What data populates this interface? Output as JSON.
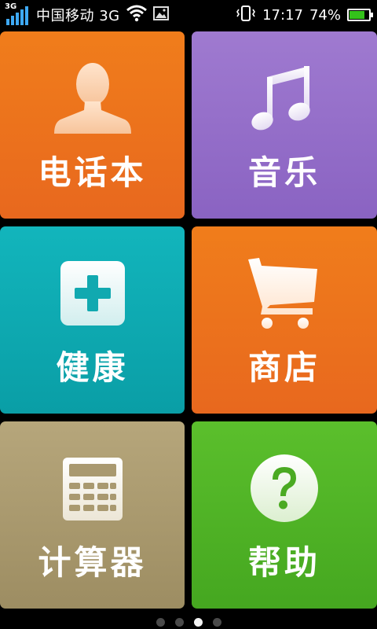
{
  "status_bar": {
    "network_tag": "3G",
    "carrier": "中国移动 3G",
    "time": "17:17",
    "battery_percent": "74%",
    "battery_level": 0.74,
    "icons": [
      "signal-icon",
      "wifi-icon",
      "image-notification-icon",
      "vibrate-icon",
      "battery-icon"
    ]
  },
  "tiles": [
    {
      "id": "phonebook",
      "label": "电话本",
      "icon": "person-icon",
      "color": "#ed741d"
    },
    {
      "id": "music",
      "label": "音乐",
      "icon": "music-note-icon",
      "color": "#9570c9"
    },
    {
      "id": "health",
      "label": "健康",
      "icon": "medical-plus-icon",
      "color": "#0faab2"
    },
    {
      "id": "store",
      "label": "商店",
      "icon": "shopping-cart-icon",
      "color": "#ed741d"
    },
    {
      "id": "calculator",
      "label": "计算器",
      "icon": "calculator-icon",
      "color": "#a99970"
    },
    {
      "id": "help",
      "label": "帮助",
      "icon": "question-mark-icon",
      "color": "#50b326"
    }
  ],
  "pager": {
    "pages": 4,
    "active_page": 3
  }
}
